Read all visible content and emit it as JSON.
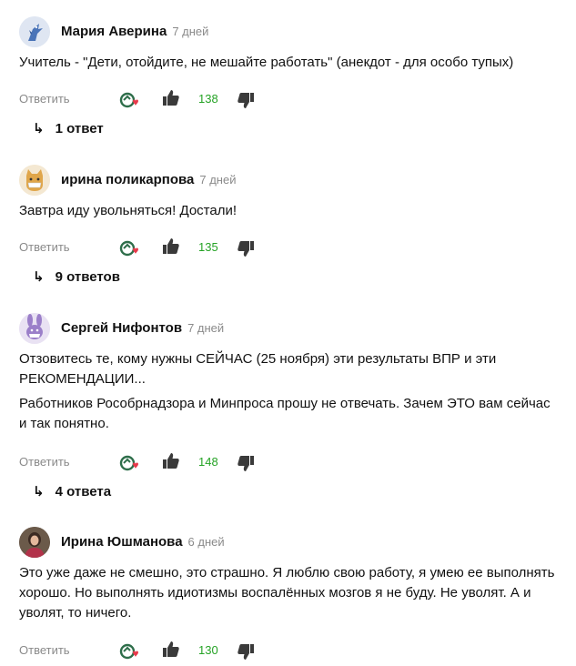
{
  "comments": [
    {
      "author": "Мария Аверина",
      "time": "7 дней",
      "text": [
        "Учитель - \"Дети, отойдите, не мешайте работать\" (анекдот - для особо тупых)"
      ],
      "likes": "138",
      "replies": "1 ответ",
      "avatar": "bird-avatar"
    },
    {
      "author": "ирина поликарпова",
      "time": "7 дней",
      "text": [
        "Завтра иду увольняться! Достали!"
      ],
      "likes": "135",
      "replies": "9 ответов",
      "avatar": "cat-mask-avatar"
    },
    {
      "author": "Сергей Нифонтов",
      "time": "7 дней",
      "text": [
        "Отзовитесь те, кому нужны СЕЙЧАС (25 ноября) эти результаты ВПР и эти РЕКОМЕНДАЦИИ...",
        "Работников Рособрнадзора и Минпроса прошу не отвечать. Зачем ЭТО вам сейчас и так понятно."
      ],
      "likes": "148",
      "replies": "4 ответа",
      "avatar": "bunny-avatar"
    },
    {
      "author": "Ирина Юшманова",
      "time": "6 дней",
      "text": [
        "Это уже даже не смешно, это страшно. Я люблю свою работу, я умею ее выполнять хорошо. Но выполнять идиотизмы воспалённых мозгов я не буду. Не уволят. А и уволят, то ничего."
      ],
      "likes": "130",
      "avatar": "photo-avatar"
    }
  ],
  "labels": {
    "reply": "Ответить"
  },
  "colors": {
    "like_count": "#26a326",
    "muted": "#8a8a8a",
    "icon": "#2f2f2f",
    "heart": "#e8394b",
    "react_green": "#2e8b57"
  }
}
